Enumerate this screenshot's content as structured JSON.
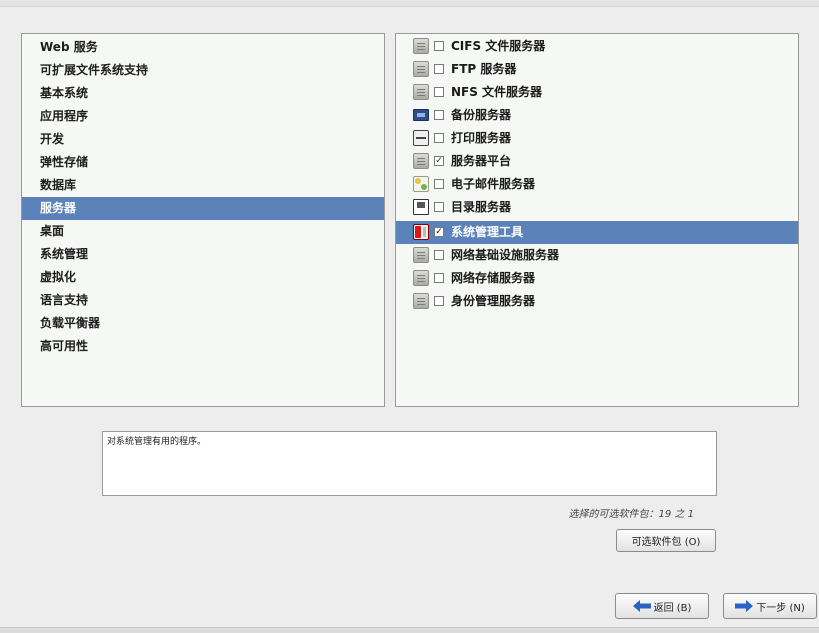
{
  "categories": {
    "items": [
      {
        "label": "Web 服务"
      },
      {
        "label": "可扩展文件系统支持"
      },
      {
        "label": "基本系统"
      },
      {
        "label": "应用程序"
      },
      {
        "label": "开发"
      },
      {
        "label": "弹性存储"
      },
      {
        "label": "数据库"
      },
      {
        "label": "服务器",
        "selected": true
      },
      {
        "label": "桌面"
      },
      {
        "label": "系统管理"
      },
      {
        "label": "虚拟化"
      },
      {
        "label": "语言支持"
      },
      {
        "label": "负载平衡器"
      },
      {
        "label": "高可用性"
      }
    ]
  },
  "options": {
    "items": [
      {
        "label": "CIFS 文件服务器",
        "checked": false,
        "icon": "server-icon"
      },
      {
        "label": "FTP 服务器",
        "checked": false,
        "icon": "server-icon"
      },
      {
        "label": "NFS 文件服务器",
        "checked": false,
        "icon": "server-icon"
      },
      {
        "label": "备份服务器",
        "checked": false,
        "icon": "backup-icon"
      },
      {
        "label": "打印服务器",
        "checked": false,
        "icon": "printer-icon"
      },
      {
        "label": "服务器平台",
        "checked": true,
        "icon": "server-icon"
      },
      {
        "label": "电子邮件服务器",
        "checked": false,
        "icon": "mail-icon"
      },
      {
        "label": "目录服务器",
        "checked": false,
        "icon": "directory-icon"
      },
      {
        "label": "系统管理工具",
        "checked": true,
        "icon": "tools-icon",
        "selected": true
      },
      {
        "label": "网络基础设施服务器",
        "checked": false,
        "icon": "server-icon"
      },
      {
        "label": "网络存储服务器",
        "checked": false,
        "icon": "server-icon"
      },
      {
        "label": "身份管理服务器",
        "checked": false,
        "icon": "server-icon"
      }
    ]
  },
  "description": "对系统管理有用的程序。",
  "package_count": "选择的可选软件包：19 之 1",
  "buttons": {
    "optional": "可选软件包 (O)",
    "back": "返回 (B)",
    "next": "下一步 (N)"
  },
  "colors": {
    "selection": "#5b83b9",
    "arrow": "#2b63c2"
  }
}
